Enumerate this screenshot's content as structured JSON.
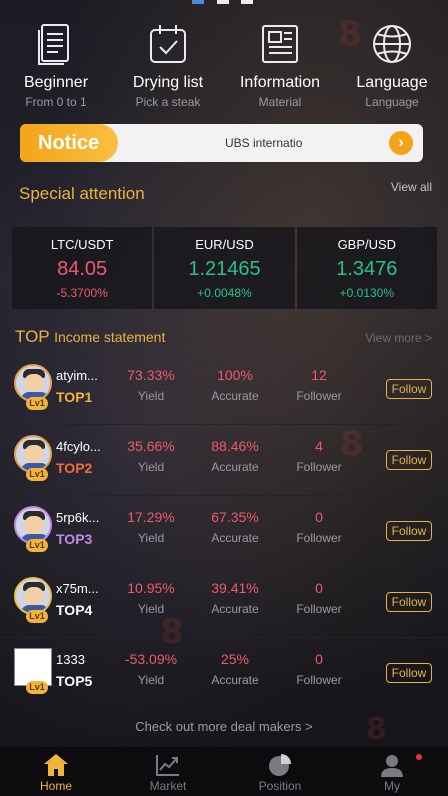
{
  "quick_links": [
    {
      "title": "Beginner",
      "subtitle": "From 0 to 1",
      "icon": "document-icon"
    },
    {
      "title": "Drying list",
      "subtitle": "Pick a steak",
      "icon": "clipboard-check-icon"
    },
    {
      "title": "Information",
      "subtitle": "Material",
      "icon": "newspaper-icon"
    },
    {
      "title": "Language",
      "subtitle": "Language",
      "icon": "globe-icon"
    }
  ],
  "notice": {
    "tag": "Notice",
    "text": "UBS internatio",
    "arrow": "›"
  },
  "special": {
    "title": "Special attention",
    "more": "View all"
  },
  "tickers": [
    {
      "pair": "LTC/USDT",
      "price": "84.05",
      "change": "-5.3700%",
      "trend": "down"
    },
    {
      "pair": "EUR/USD",
      "price": "1.21465",
      "change": "+0.0048%",
      "trend": "up"
    },
    {
      "pair": "GBP/USD",
      "price": "1.3476",
      "change": "+0.0130%",
      "trend": "up"
    }
  ],
  "income": {
    "top": "TOP",
    "title": "Income statement",
    "more": "View more >"
  },
  "labels": {
    "yield": "Yield",
    "accurate": "Accurate",
    "follower": "Follower",
    "follow": "Follow",
    "level": "Lv1"
  },
  "traders": [
    {
      "name": "atyim...",
      "rank": "TOP1",
      "rank_color": "#f0b43a",
      "yield": "73.33%",
      "accurate": "100%",
      "followers": "12",
      "avatar": "cartoon"
    },
    {
      "name": "4fcylo...",
      "rank": "TOP2",
      "rank_color": "#f26b3a",
      "yield": "35.66%",
      "accurate": "88.46%",
      "followers": "4",
      "avatar": "cartoon"
    },
    {
      "name": "5rp6k...",
      "rank": "TOP3",
      "rank_color": "#c38ae5",
      "yield": "17.29%",
      "accurate": "67.35%",
      "followers": "0",
      "avatar": "cartoon"
    },
    {
      "name": "x75m...",
      "rank": "TOP4",
      "rank_color": "#ffffff",
      "yield": "10.95%",
      "accurate": "39.41%",
      "followers": "0",
      "avatar": "cartoon"
    },
    {
      "name": "1333",
      "rank": "TOP5",
      "rank_color": "#ffffff",
      "yield": "-53.09%",
      "accurate": "25%",
      "followers": "0",
      "avatar": "broken"
    }
  ],
  "deal_link": "Check out more deal makers  >",
  "tabs": [
    {
      "label": "Home",
      "icon": "home-icon",
      "active": true
    },
    {
      "label": "Market",
      "icon": "chart-icon",
      "active": false
    },
    {
      "label": "Position",
      "icon": "pie-icon",
      "active": false
    },
    {
      "label": "My",
      "icon": "user-icon",
      "active": false
    }
  ],
  "colors": {
    "accent": "#e7b441",
    "down": "#ec5a6e",
    "up": "#2bc08a",
    "notice": "#f4a418"
  }
}
